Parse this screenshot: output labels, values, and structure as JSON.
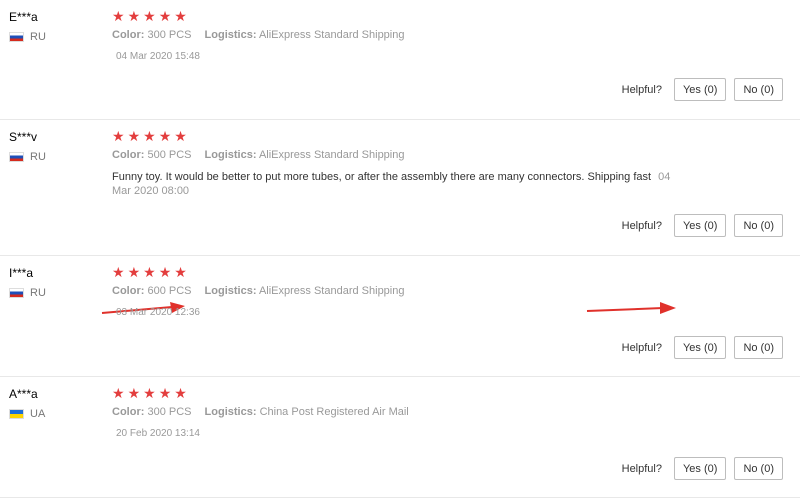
{
  "helpful_label": "Helpful?",
  "yes_label": "Yes (0)",
  "no_label": "No (0)",
  "color_key": "Color:",
  "logistics_key": "Logistics:",
  "accent_star_color": "#e33e3e",
  "reviews": [
    {
      "user": "E***a",
      "country": "RU",
      "flag_icon": "flag-ru-icon",
      "color": "300 PCS",
      "logistics": "AliExpress Standard Shipping",
      "date": "04 Mar 2020 15:48",
      "rating_stars": 5
    },
    {
      "user": "S***v",
      "country": "RU",
      "flag_icon": "flag-ru-icon",
      "color": "500 PCS",
      "logistics": "AliExpress Standard Shipping",
      "feedback": "Funny toy. It would be better to put more tubes, or after the assembly there are many connectors. Shipping fast",
      "date": "04 Mar 2020 08:00",
      "rating_stars": 5
    },
    {
      "user": "I***a",
      "country": "RU",
      "flag_icon": "flag-ru-icon",
      "color": "600 PCS",
      "logistics": "AliExpress Standard Shipping",
      "date": "03 Mar 2020 12:36",
      "rating_stars": 5
    },
    {
      "user": "A***a",
      "country": "UA",
      "flag_icon": "flag-ua-icon",
      "color": "300 PCS",
      "logistics": "China Post Registered Air Mail",
      "date": "20 Feb 2020 13:14",
      "rating_stars": 5
    }
  ]
}
